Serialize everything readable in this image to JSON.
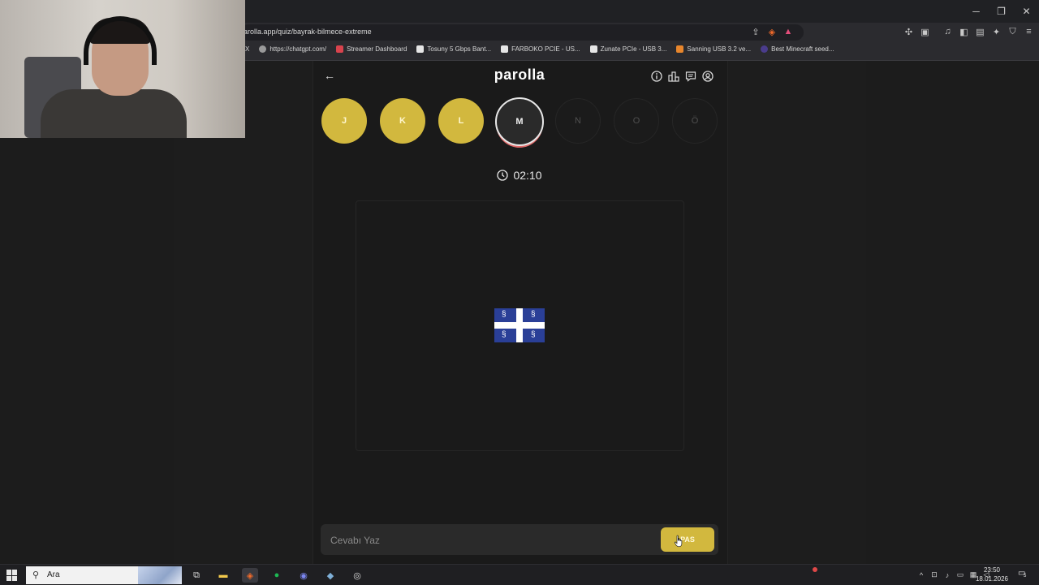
{
  "browser": {
    "url": "arolla.app/quiz/bayrak-bilmece-extreme",
    "bookmarks": [
      {
        "label": "X"
      },
      {
        "label": "https://chatgpt.com/"
      },
      {
        "label": "Streamer Dashboard"
      },
      {
        "label": "Tosuny 5 Gbps Bant..."
      },
      {
        "label": "FARBOKO PCIE - US..."
      },
      {
        "label": "Zunate PCIe - USB 3..."
      },
      {
        "label": "Sanning USB 3.2 ve..."
      },
      {
        "label": "Best Minecraft seed..."
      }
    ]
  },
  "app": {
    "logo": "parolla",
    "letters": [
      {
        "char": "J",
        "state": "done"
      },
      {
        "char": "K",
        "state": "done"
      },
      {
        "char": "L",
        "state": "done"
      },
      {
        "char": "M",
        "state": "current"
      },
      {
        "char": "N",
        "state": "pending"
      },
      {
        "char": "O",
        "state": "pending"
      },
      {
        "char": "Ö",
        "state": "pending"
      }
    ],
    "timer": "02:10",
    "answer_placeholder": "Cevabı Yaz",
    "pass_label": "PAS",
    "accent_color": "#d2b83e"
  },
  "taskbar": {
    "search_placeholder": "Ara",
    "time": "23:50",
    "date": "18.01.2026",
    "notification_count": "5"
  }
}
